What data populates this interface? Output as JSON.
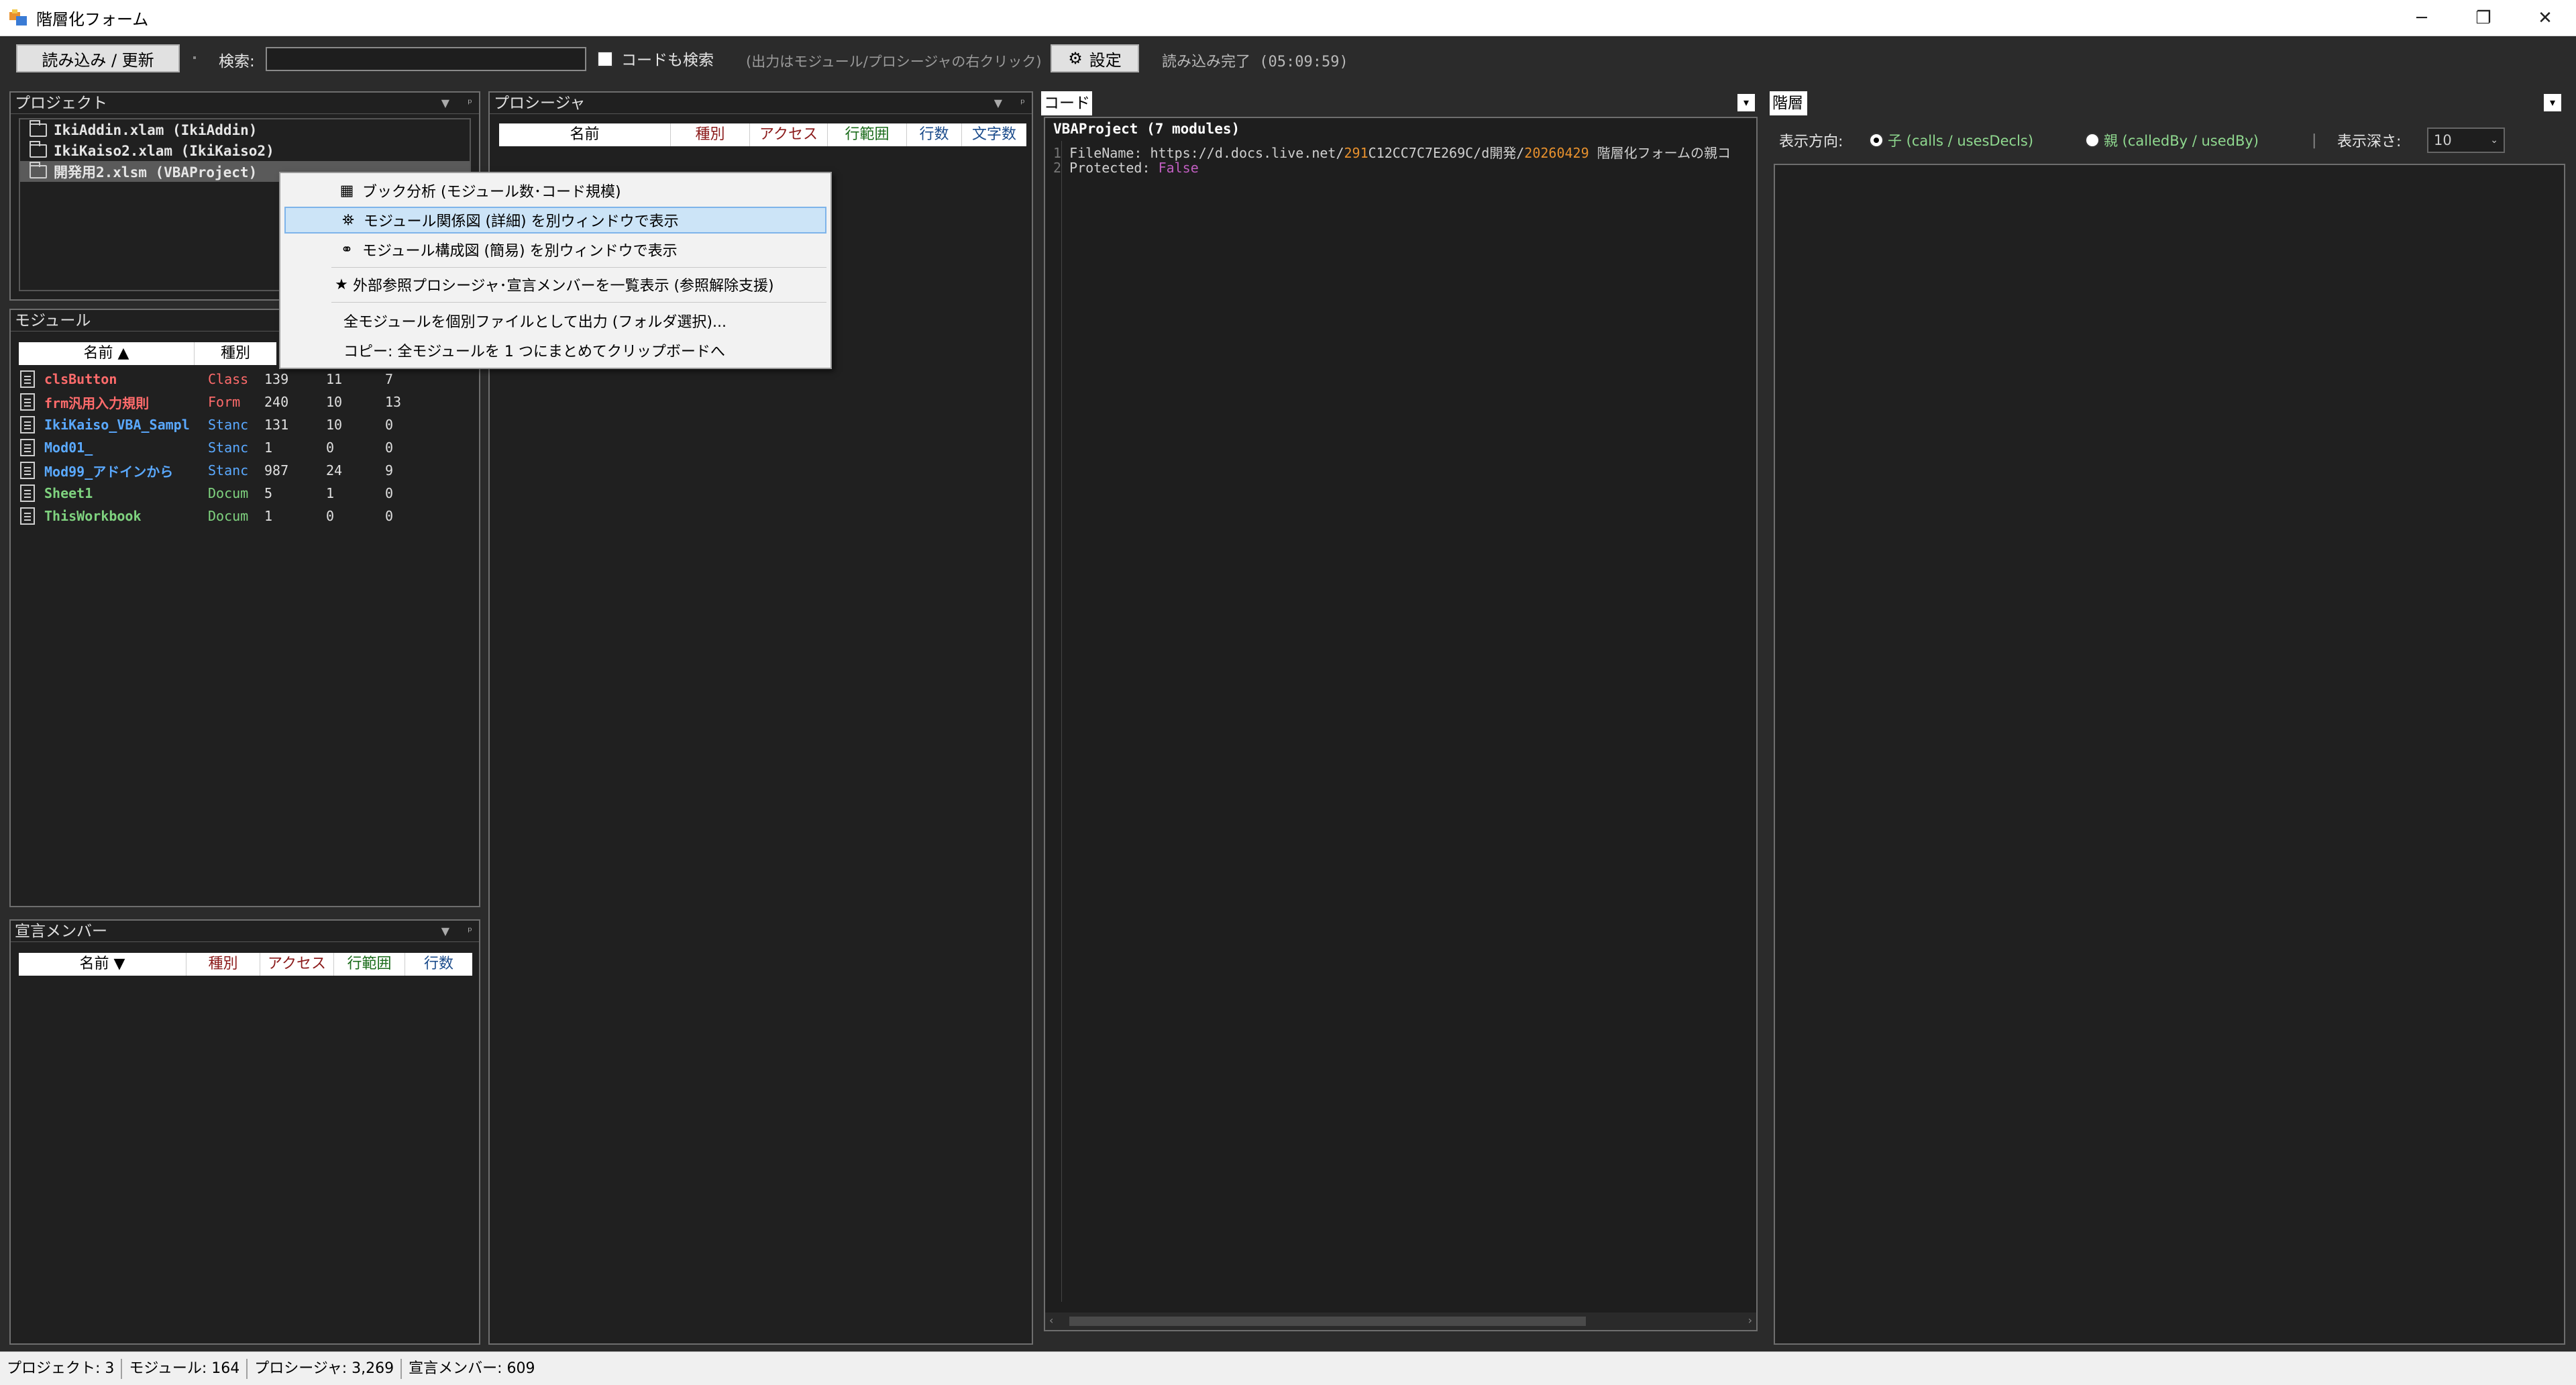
{
  "window": {
    "title": "階層化フォーム"
  },
  "toolbar": {
    "reload_label": "読み込み / 更新",
    "search_label": "検索:",
    "search_value": "",
    "code_search_label": "コードも検索",
    "hint": "(出力はモジュール/プロシージャの右クリック)",
    "settings_label": "設定",
    "status": "読み込み完了 (05:09:59)"
  },
  "project_panel": {
    "title": "プロジェクト",
    "items": [
      "IkiAddin.xlam (IkiAddin)",
      "IkiKaiso2.xlam (IkiKaiso2)",
      "開発用2.xlsm (VBAProject)"
    ]
  },
  "module_panel": {
    "title": "モジュール",
    "columns": [
      "名前 ▲",
      "種別"
    ],
    "rows": [
      {
        "name": "clsButton",
        "type": "Class",
        "a": "139",
        "b": "11",
        "c": "7",
        "color": "#ff6b6b"
      },
      {
        "name": "frm汎用入力規則",
        "type": "Form",
        "a": "240",
        "b": "10",
        "c": "13",
        "color": "#ff6b6b"
      },
      {
        "name": "IkiKaiso_VBA_Sampl",
        "type": "Stanc",
        "a": "131",
        "b": "10",
        "c": "0",
        "color": "#5aa9ff"
      },
      {
        "name": "Mod01_",
        "type": "Stanc",
        "a": "1",
        "b": "0",
        "c": "0",
        "color": "#5aa9ff"
      },
      {
        "name": "Mod99_アドインから",
        "type": "Stanc",
        "a": "987",
        "b": "24",
        "c": "9",
        "color": "#5aa9ff"
      },
      {
        "name": "Sheet1",
        "type": "Docum",
        "a": "5",
        "b": "1",
        "c": "0",
        "color": "#7fd37f"
      },
      {
        "name": "ThisWorkbook",
        "type": "Docum",
        "a": "1",
        "b": "0",
        "c": "0",
        "color": "#7fd37f"
      }
    ]
  },
  "member_panel": {
    "title": "宣言メンバー",
    "columns": [
      "名前 ▼",
      "種別",
      "アクセス",
      "行範囲",
      "行数"
    ]
  },
  "procedure_panel": {
    "title": "プロシージャ",
    "columns": [
      "名前",
      "種別",
      "アクセス",
      "行範囲",
      "行数",
      "文字数"
    ]
  },
  "context_menu": {
    "items": [
      {
        "icon": "▦",
        "label": "ブック分析 (モジュール数･コード規模)"
      },
      {
        "icon": "⛯",
        "label": "モジュール関係図 (詳細) を別ウィンドウで表示"
      },
      {
        "icon": "⚭",
        "label": "モジュール構成図 (簡易) を別ウィンドウで表示"
      },
      {
        "icon": "★",
        "label": "外部参照プロシージャ･宣言メンバーを一覧表示 (参照解除支援)"
      },
      {
        "icon": "",
        "label": "全モジュールを個別ファイルとして出力 (フォルダ選択)..."
      },
      {
        "icon": "",
        "label": "コピー: 全モジュールを 1 つにまとめてクリップボードへ"
      }
    ]
  },
  "code_panel": {
    "title": "コード",
    "header": "VBAProject  (7 modules)",
    "line1_num": "1",
    "line1_key": "FileName:",
    "line1_url": "https://d.docs.live.net/",
    "line1_id": "291",
    "line1_hash": "C12CC7C7E269C/d開発/",
    "line1_date": "20260429",
    "line1_rest": " 階層化フォームの親コ",
    "line2_num": "2",
    "line2_key": "Protected:",
    "line2_val": "False"
  },
  "hierarchy_panel": {
    "title": "階層",
    "direction_label": "表示方向:",
    "child_label": "子 (calls / usesDecls)",
    "parent_label": "親 (calledBy / usedBy)",
    "depth_label": "表示深さ:",
    "depth_value": "10"
  },
  "statusbar": {
    "projects": "プロジェクト: 3",
    "modules": "モジュール: 164",
    "procedures": "プロシージャ: 3,269",
    "members": "宣言メンバー: 609"
  },
  "colors": {
    "class": "#ff6b6b",
    "standard": "#5aa9ff",
    "document": "#7fd37f",
    "accent_orange": "#e8912d",
    "false_purple": "#c05ec0",
    "highlight": "#cce4f7"
  }
}
